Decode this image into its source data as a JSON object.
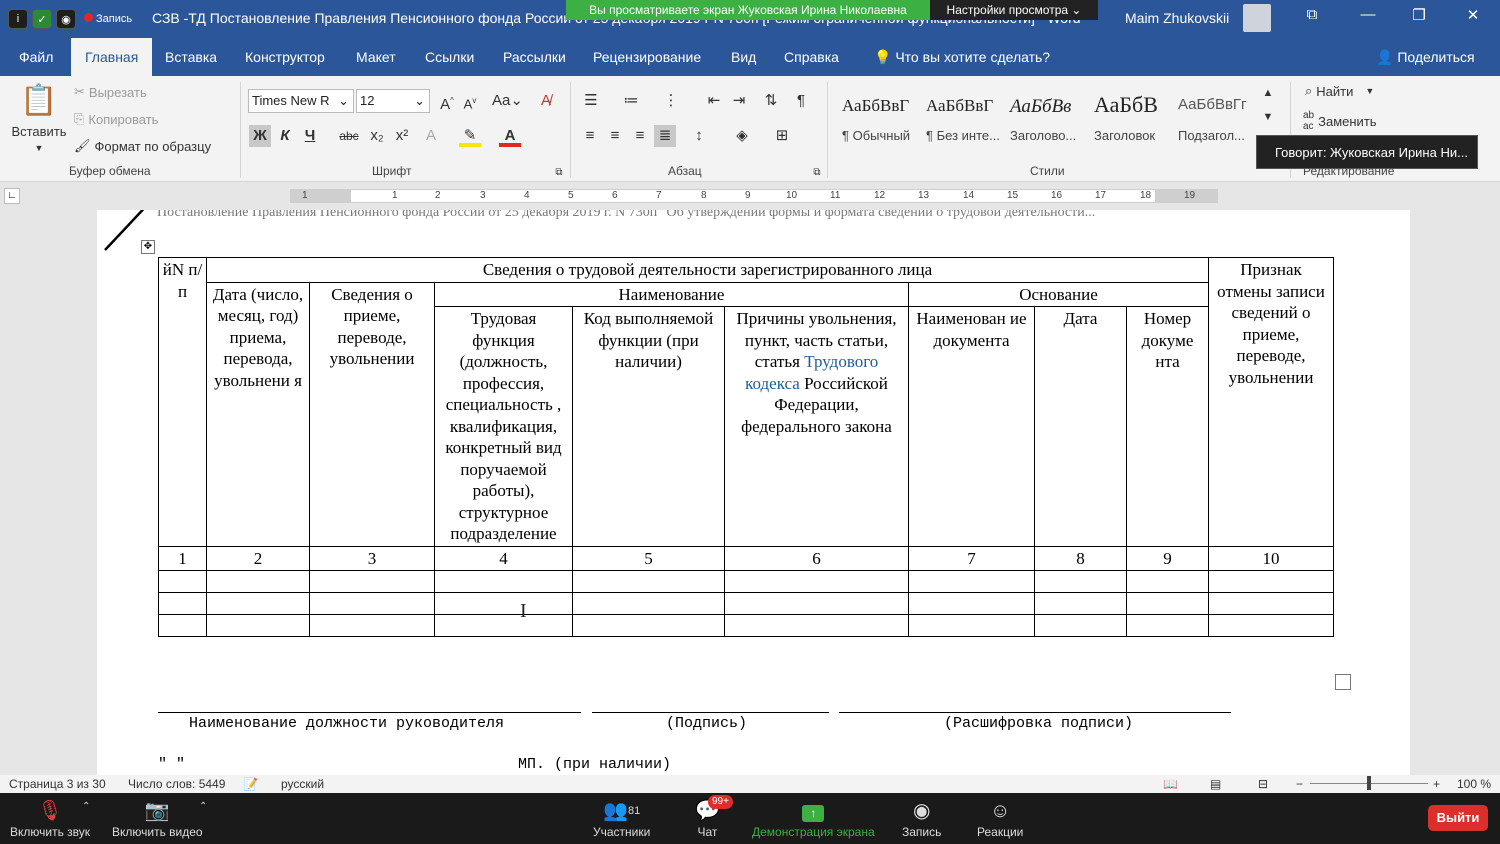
{
  "titlebar": {
    "title": "СЗВ -ТД Постановление Правления Пенсионного фонда России от 25 декабря 2019 г N 730п [Режим ограниченной функциональности] - Word",
    "user": "Maim Zhukovskii",
    "recording": "Запись",
    "share_banner": "Вы просматриваете экран Жуковская Ирина Николаевна",
    "view_settings": "Настройки просмотра ⌄"
  },
  "menu": {
    "tabs": [
      "Файл",
      "Главная",
      "Вставка",
      "Конструктор",
      "Макет",
      "Ссылки",
      "Рассылки",
      "Рецензирование",
      "Вид",
      "Справка"
    ],
    "tell_me": "Что вы хотите сделать?",
    "share": "Поделиться"
  },
  "ribbon": {
    "paste": "Вставить",
    "cut": "Вырезать",
    "copy": "Копировать",
    "format_painter": "Формат по образцу",
    "clipboard_label": "Буфер обмена",
    "font_name": "Times New R",
    "font_size": "12",
    "font_label": "Шрифт",
    "paragraph_label": "Абзац",
    "styles_label": "Стили",
    "editing_label": "Редактирование",
    "find": "Найти",
    "replace": "Заменить",
    "styles": [
      {
        "sample": "АаБбВвГ",
        "name": "¶ Обычный"
      },
      {
        "sample": "АаБбВвГ",
        "name": "¶ Без инте..."
      },
      {
        "sample": "АаБбВв",
        "name": "Заголово..."
      },
      {
        "sample": "АаБбВ",
        "name": "Заголовок"
      },
      {
        "sample": "АаБбВвГг",
        "name": "Подзагол..."
      }
    ],
    "tooltip": "Говорит: Жуковская Ирина Ни..."
  },
  "ruler": [
    "1",
    "1",
    "2",
    "3",
    "4",
    "5",
    "6",
    "7",
    "8",
    "9",
    "10",
    "11",
    "12",
    "13",
    "14",
    "15",
    "16",
    "17",
    "18",
    "19"
  ],
  "document": {
    "header": "Постановление Правления Пенсионного фонда России от 25 декабря 2019 г. N 730п \"Об утверждении формы и формата сведений о трудовой деятельности...",
    "table": {
      "col1": "йN п/п",
      "group_title": "Сведения о трудовой деятельности зарегистрированного лица",
      "cancel_sign": "Признак отмены записи сведений о приеме, переводе, увольнении",
      "date": "Дата (число, месяц, год) приема, перевода, увольнени я",
      "info": "Сведения о приеме, переводе, увольнении",
      "naming": "Наименование",
      "basis": "Основание",
      "labor_function": "Трудовая функция (должность, профессия, специальность , квалификация, конкретный вид поручаемой работы), структурное подразделение",
      "code": "Код выполняемой функции (при наличии)",
      "reasons_a": "Причины увольнения, пункт, часть статьи, статья",
      "reasons_link": "Трудового кодекса",
      "reasons_b": "Российской Федерации, федерального закона",
      "doc_name": "Наименован ие документа",
      "doc_date": "Дата",
      "doc_number": "Номер докуме нта",
      "numbers": [
        "1",
        "2",
        "3",
        "4",
        "5",
        "6",
        "7",
        "8",
        "9",
        "10"
      ]
    },
    "sig_position": "Наименование должности руководителя",
    "sig_signature": "(Подпись)",
    "sig_decode": "(Расшифровка подписи)",
    "date_quotes": "\"     \"",
    "stamp": "МП. (при наличии)"
  },
  "statusbar": {
    "page": "Страница 3 из 30",
    "words": "Число слов: 5449",
    "language": "русский",
    "zoom": "100 %"
  },
  "meeting": {
    "mute": "Включить звук",
    "video": "Включить видео",
    "participants": "Участники",
    "participants_count": "81",
    "chat": "Чат",
    "chat_badge": "99+",
    "share": "Демонстрация экрана",
    "record": "Запись",
    "reactions": "Реакции",
    "leave": "Выйти"
  }
}
